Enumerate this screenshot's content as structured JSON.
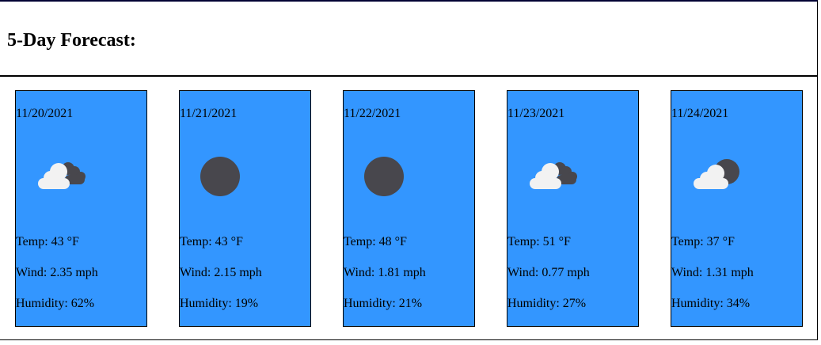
{
  "header": {
    "title": "5-Day Forecast:"
  },
  "forecast": [
    {
      "date": "11/20/2021",
      "icon": "clouds-icon",
      "temp": "Temp: 43 °F",
      "wind": "Wind: 2.35 mph",
      "humidity": "Humidity: 62%"
    },
    {
      "date": "11/21/2021",
      "icon": "clear-sky-icon",
      "temp": "Temp: 43 °F",
      "wind": "Wind: 2.15 mph",
      "humidity": "Humidity: 19%"
    },
    {
      "date": "11/22/2021",
      "icon": "clear-sky-icon",
      "temp": "Temp: 48 °F",
      "wind": "Wind: 1.81 mph",
      "humidity": "Humidity: 21%"
    },
    {
      "date": "11/23/2021",
      "icon": "clouds-icon",
      "temp": "Temp: 51 °F",
      "wind": "Wind: 0.77 mph",
      "humidity": "Humidity: 27%"
    },
    {
      "date": "11/24/2021",
      "icon": "few-clouds-icon",
      "temp": "Temp: 37 °F",
      "wind": "Wind: 1.31 mph",
      "humidity": "Humidity: 34%"
    }
  ],
  "colors": {
    "card_background": "#3396ff",
    "icon_dark": "#48474d",
    "icon_cloud": "#f2f2f2"
  }
}
